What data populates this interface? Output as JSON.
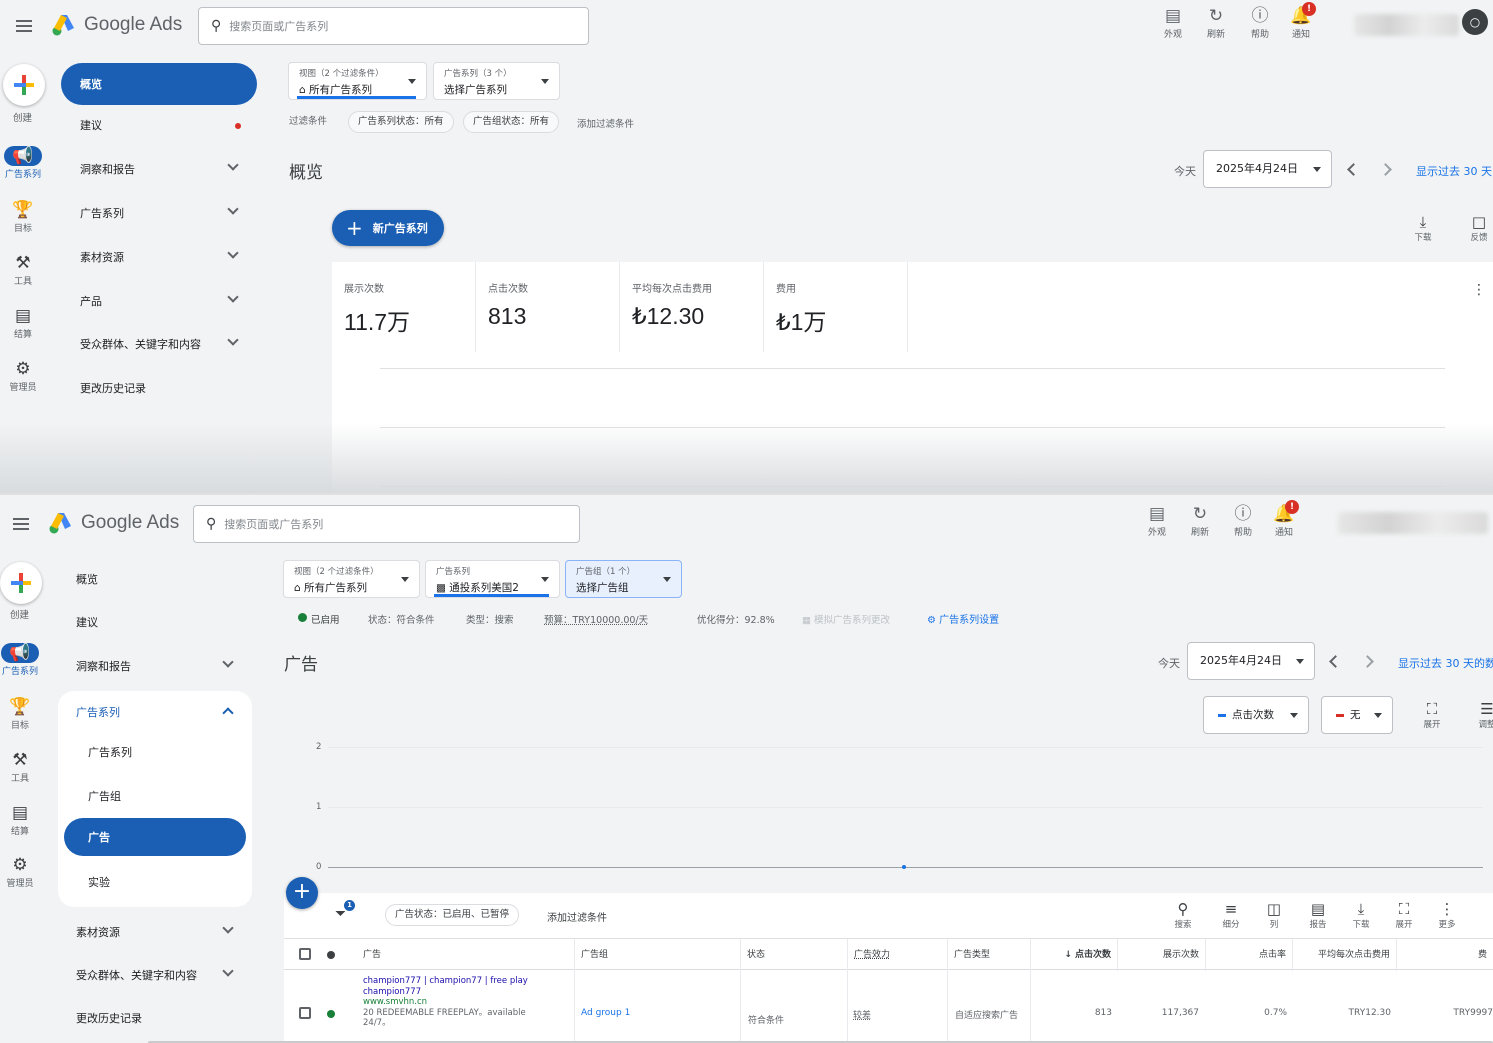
{
  "app": {
    "logo_text": "Google Ads",
    "search_placeholder": "搜索页面或广告系列"
  },
  "topbar": {
    "appearance": "外观",
    "refresh": "刷新",
    "help": "帮助",
    "notifications": "通知",
    "notification_badge": "!"
  },
  "rail": {
    "create": "创建",
    "campaigns": "广告系列",
    "goals": "目标",
    "tools": "工具",
    "billing": "结算",
    "admin": "管理员"
  },
  "pane1": {
    "nav": [
      {
        "label": "概览"
      },
      {
        "label": "建议"
      },
      {
        "label": "洞察和报告"
      },
      {
        "label": "广告系列"
      },
      {
        "label": "素材资源"
      },
      {
        "label": "产品"
      },
      {
        "label": "受众群体、关键字和内容"
      },
      {
        "label": "更改历史记录"
      }
    ],
    "view_selector": {
      "caption": "视图（2 个过滤条件）",
      "value": "所有广告系列"
    },
    "campaign_selector": {
      "caption": "广告系列（3 个）",
      "value": "选择广告系列"
    },
    "filters_label": "过滤条件",
    "filter_chips": [
      "广告系列状态：所有",
      "广告组状态：所有"
    ],
    "add_filter": "添加过滤条件",
    "page_title": "概览",
    "today_label": "今天",
    "date_value": "2025年4月24日",
    "show_last": "显示过去 30 天",
    "new_campaign": "新广告系列",
    "download": "下载",
    "feedback": "反馈",
    "metrics": [
      {
        "label": "展示次数",
        "value": "11.7万"
      },
      {
        "label": "点击次数",
        "value": "813"
      },
      {
        "label": "平均每次点击费用",
        "value": "₺12.30"
      },
      {
        "label": "费用",
        "value": "₺1万"
      }
    ]
  },
  "pane2": {
    "nav": {
      "overview": "概览",
      "recommendations": "建议",
      "insights": "洞察和报告",
      "campaigns_group": "广告系列",
      "campaigns_sub": [
        "广告系列",
        "广告组",
        "广告",
        "实验"
      ],
      "assets": "素材资源",
      "audiences": "受众群体、关键字和内容",
      "history": "更改历史记录"
    },
    "view_selector": {
      "caption": "视图（2 个过滤条件）",
      "value": "所有广告系列"
    },
    "campaign_selector": {
      "caption": "广告系列",
      "value": "通投系列美国2"
    },
    "adgroup_selector": {
      "caption": "广告组（1 个）",
      "value": "选择广告组"
    },
    "status_bar": {
      "enabled": "已启用",
      "status": "状态：符合条件",
      "type": "类型：搜索",
      "budget": "预算：TRY10000.00/天",
      "opt_score": "优化得分：92.8%",
      "simulate": "模拟广告系列更改",
      "settings": "广告系列设置"
    },
    "page_title": "广告",
    "today_label": "今天",
    "date_value": "2025年4月24日",
    "show_last": "显示过去 30 天的数",
    "metric_dropdown_1": "点击次数",
    "metric_dropdown_2": "无",
    "expand": "展开",
    "adjust": "调整",
    "chart_yticks": [
      "2",
      "1",
      "0"
    ],
    "filter_chip": "广告状态：已启用、已暂停",
    "add_filter": "添加过滤条件",
    "filter_badge": "1",
    "tools": [
      "搜索",
      "细分",
      "列",
      "报告",
      "下载",
      "展开",
      "更多"
    ],
    "table": {
      "headers": [
        "广告",
        "广告组",
        "状态",
        "广告效力",
        "广告类型",
        "↓ 点击次数",
        "展示次数",
        "点击率",
        "平均每次点击费用",
        "费"
      ],
      "row": {
        "ad_lines": [
          "champion777 | champion77 | free play",
          "champion777",
          "www.smvhn.cn",
          "20 REDEEMABLE FREEPLAY。available",
          "24/7。"
        ],
        "ad_group": "Ad group 1",
        "status": "符合条件",
        "strength": "较差",
        "type": "自适应搜索广告",
        "clicks": "813",
        "impressions": "117,367",
        "ctr": "0.7%",
        "avg_cpc": "TRY12.30",
        "cost": "TRY9997"
      }
    }
  },
  "colors": {
    "accent": "#1a5fb4",
    "link": "#1a73e8",
    "badge": "#d93025",
    "enabled": "#188038"
  }
}
